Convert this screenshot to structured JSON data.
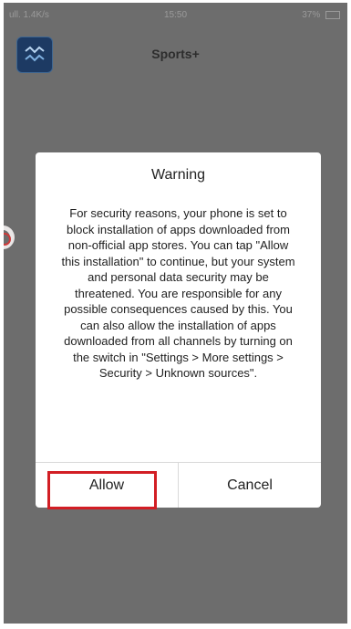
{
  "status_bar": {
    "left": "ull. 1.4K/s",
    "time": "15:50",
    "right": "37%"
  },
  "app_bar": {
    "title": "Sports+",
    "icon": "app-logo-icon"
  },
  "dialog": {
    "title": "Warning",
    "message": "For security reasons, your phone is set to block installation of apps downloaded from non-official app stores. You can tap \"Allow this installation\" to continue, but your system and personal data security may be threatened. You are responsible for any possible consequences caused by this. You can also allow the installation of apps downloaded from all channels by turning on the switch in \"Settings > More settings > Security > Unknown sources\".",
    "allow_label": "Allow",
    "cancel_label": "Cancel"
  },
  "colors": {
    "overlay": "#6d6d6d",
    "highlight": "#d21e24"
  }
}
